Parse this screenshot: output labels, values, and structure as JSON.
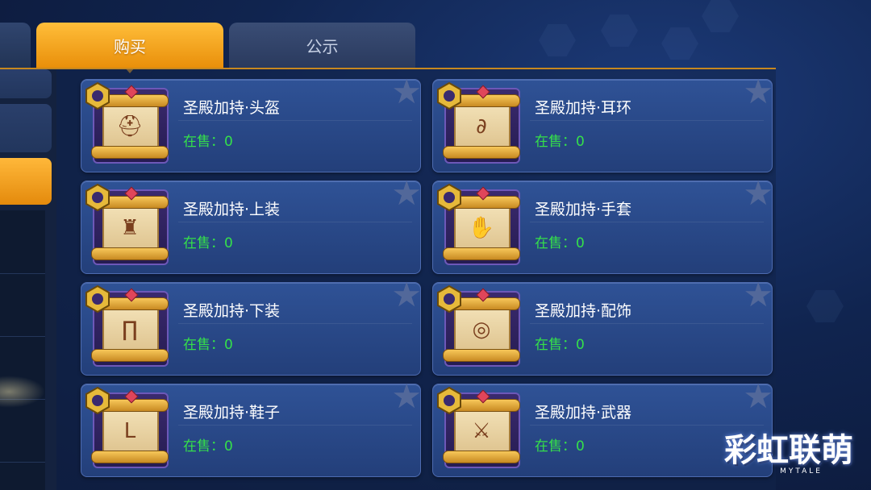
{
  "tabs": {
    "buy_label": "购买",
    "notice_label": "公示"
  },
  "listings": [
    {
      "title": "圣殿加持·头盔",
      "count_label": "在售：0",
      "item_icon": "helmet-icon"
    },
    {
      "title": "圣殿加持·耳环",
      "count_label": "在售：0",
      "item_icon": "earring-icon"
    },
    {
      "title": "圣殿加持·上装",
      "count_label": "在售：0",
      "item_icon": "top-armor-icon"
    },
    {
      "title": "圣殿加持·手套",
      "count_label": "在售：0",
      "item_icon": "glove-icon"
    },
    {
      "title": "圣殿加持·下装",
      "count_label": "在售：0",
      "item_icon": "pants-icon"
    },
    {
      "title": "圣殿加持·配饰",
      "count_label": "在售：0",
      "item_icon": "accessory-icon"
    },
    {
      "title": "圣殿加持·鞋子",
      "count_label": "在售：0",
      "item_icon": "boots-icon"
    },
    {
      "title": "圣殿加持·武器",
      "count_label": "在售：0",
      "item_icon": "weapon-icon"
    }
  ],
  "logo": {
    "title": "彩虹联萌",
    "subtitle": "MYTALE"
  },
  "colors": {
    "tab_active": "#f0a020",
    "count_text": "#35e04a",
    "card_bg": "#2a4a8c"
  }
}
